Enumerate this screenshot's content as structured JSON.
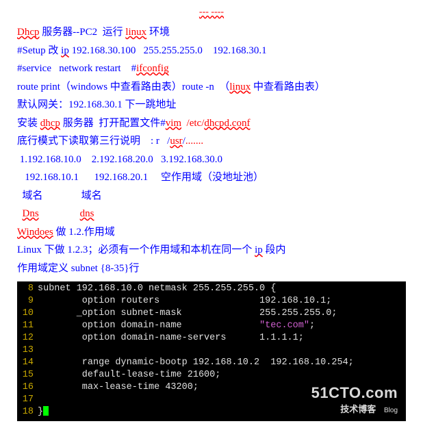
{
  "top": "---     ----",
  "lines": [
    {
      "segs": [
        {
          "t": "Dhcp",
          "cls": "blue red-wavy"
        },
        {
          "t": " 服务器--PC2  运行 ",
          "cls": "blue"
        },
        {
          "t": "linux",
          "cls": "blue red-wavy"
        },
        {
          "t": " 环境",
          "cls": "blue"
        }
      ]
    },
    {
      "segs": [
        {
          "t": "#Setup 改 ",
          "cls": "blue"
        },
        {
          "t": "ip",
          "cls": "blue blue-wavy"
        },
        {
          "t": " 192.168.30.100   255.255.255.0    192.168.30.1",
          "cls": "blue"
        }
      ]
    },
    {
      "segs": [
        {
          "t": "#service   network restart    #",
          "cls": "blue"
        },
        {
          "t": "ifconfig",
          "cls": "blue red-wavy"
        }
      ]
    },
    {
      "segs": [
        {
          "t": "route print（windows 中查看路由表）route -n  （",
          "cls": "blue"
        },
        {
          "t": "linux",
          "cls": "blue red-wavy"
        },
        {
          "t": " 中查看路由表）",
          "cls": "blue"
        }
      ]
    },
    {
      "segs": [
        {
          "t": "默认网关：192.168.30.1 下一跳地址",
          "cls": "blue"
        }
      ]
    },
    {
      "segs": [
        {
          "t": "安装 ",
          "cls": "blue"
        },
        {
          "t": "dhcp",
          "cls": "blue red-wavy"
        },
        {
          "t": " 服务器  打开配置文件#",
          "cls": "blue"
        },
        {
          "t": "vim",
          "cls": "blue red-wavy"
        },
        {
          "t": "  ",
          "cls": "blue"
        },
        {
          "t": "/etc/",
          "cls": "red"
        },
        {
          "t": "dhcpd.conf",
          "cls": "red red-wavy"
        }
      ]
    },
    {
      "segs": [
        {
          "t": "底行模式下读取第三行说明    : r   /",
          "cls": "blue"
        },
        {
          "t": "usr",
          "cls": "blue red-wavy"
        },
        {
          "t": "/",
          "cls": "blue"
        },
        {
          "t": ".......",
          "cls": "red"
        }
      ]
    },
    {
      "segs": [
        {
          "t": " 1.192.168.10.0    2.192.168.20.0   3.192.168.30.0",
          "cls": "blue"
        }
      ]
    },
    {
      "segs": [
        {
          "t": "   192.168.10.1      192.168.20.1     空作用域（没地址池）",
          "cls": "blue"
        }
      ]
    },
    {
      "segs": [
        {
          "t": "  域名               域名",
          "cls": "blue"
        }
      ]
    },
    {
      "segs": [
        {
          "t": "  ",
          "cls": ""
        },
        {
          "t": "Dns",
          "cls": "blue red-wavy"
        },
        {
          "t": "                ",
          "cls": ""
        },
        {
          "t": "dns",
          "cls": "blue red-wavy"
        }
      ]
    },
    {
      "segs": [
        {
          "t": "Windoes",
          "cls": "blue red-wavy"
        },
        {
          "t": " 做 1.2.作用域",
          "cls": "blue"
        }
      ]
    },
    {
      "segs": [
        {
          "t": "Linux 下做 1.2.3；必须有一个作用域和本机在同一个 ",
          "cls": "blue"
        },
        {
          "t": "ip",
          "cls": "blue blue-wavy"
        },
        {
          "t": " 段内",
          "cls": "blue"
        }
      ]
    },
    {
      "segs": [
        {
          "t": "作用域定义 subnet {8-35}行",
          "cls": "blue"
        }
      ]
    }
  ],
  "terminal": {
    "rows": [
      {
        "n": "8",
        "text": "subnet 192.168.10.0 netmask 255.255.255.0 {"
      },
      {
        "n": "9",
        "text": "        option routers                  192.168.10.1;"
      },
      {
        "n": "10",
        "text": "       _option subnet-mask              255.255.255.0;"
      },
      {
        "n": "11",
        "text": "        option domain-name              ",
        "tail": "\"tec.com\"",
        "after": ";"
      },
      {
        "n": "12",
        "text": "        option domain-name-servers      1.1.1.1;"
      },
      {
        "n": "13",
        "text": ""
      },
      {
        "n": "14",
        "text": "        range dynamic-bootp 192.168.10.2  192.168.10.254;"
      },
      {
        "n": "15",
        "text": "        default-lease-time 21600;"
      },
      {
        "n": "16",
        "text": "        max-lease-time 43200;"
      },
      {
        "n": "17",
        "text": ""
      },
      {
        "n": "18",
        "text": "}",
        "cursor": true
      }
    ]
  },
  "watermark": {
    "main": "51CTO.com",
    "sub": "技术博客",
    "blog": "Blog"
  }
}
